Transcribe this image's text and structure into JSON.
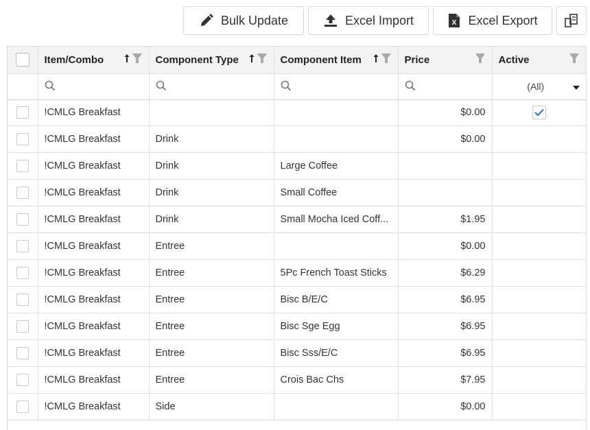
{
  "toolbar": {
    "bulk_update": "Bulk Update",
    "excel_import": "Excel Import",
    "excel_export": "Excel Export",
    "column_chooser_icon": "column-chooser-icon"
  },
  "columns": {
    "item_combo": "Item/Combo",
    "component_type": "Component Type",
    "component_item": "Component Item",
    "price": "Price",
    "active": "Active"
  },
  "filters": {
    "active_selected": "(All)"
  },
  "rows": [
    {
      "item": "!CMLG Breakfast",
      "type": "",
      "component": "",
      "price": "$0.00",
      "active": true
    },
    {
      "item": "!CMLG Breakfast",
      "type": "Drink",
      "component": "",
      "price": "$0.00",
      "active": false
    },
    {
      "item": "!CMLG Breakfast",
      "type": "Drink",
      "component": "Large Coffee",
      "price": "",
      "active": false
    },
    {
      "item": "!CMLG Breakfast",
      "type": "Drink",
      "component": "Small Coffee",
      "price": "",
      "active": false
    },
    {
      "item": "!CMLG Breakfast",
      "type": "Drink",
      "component": "Small Mocha Iced Coff...",
      "price": "$1.95",
      "active": false
    },
    {
      "item": "!CMLG Breakfast",
      "type": "Entree",
      "component": "",
      "price": "$0.00",
      "active": false
    },
    {
      "item": "!CMLG Breakfast",
      "type": "Entree",
      "component": "5Pc French Toast Sticks",
      "price": "$6.29",
      "active": false
    },
    {
      "item": "!CMLG Breakfast",
      "type": "Entree",
      "component": "Bisc B/E/C",
      "price": "$6.95",
      "active": false
    },
    {
      "item": "!CMLG Breakfast",
      "type": "Entree",
      "component": "Bisc Sge Egg",
      "price": "$6.95",
      "active": false
    },
    {
      "item": "!CMLG Breakfast",
      "type": "Entree",
      "component": "Bisc Sss/E/C",
      "price": "$6.95",
      "active": false
    },
    {
      "item": "!CMLG Breakfast",
      "type": "Entree",
      "component": "Crois Bac Chs",
      "price": "$7.95",
      "active": false
    },
    {
      "item": "!CMLG Breakfast",
      "type": "Side",
      "component": "",
      "price": "$0.00",
      "active": false
    }
  ],
  "colors": {
    "border": "#d8d8d8",
    "header_bg": "#f3f3f3",
    "check_blue": "#3a7bbf",
    "icon_gray": "#9e9e9e"
  }
}
